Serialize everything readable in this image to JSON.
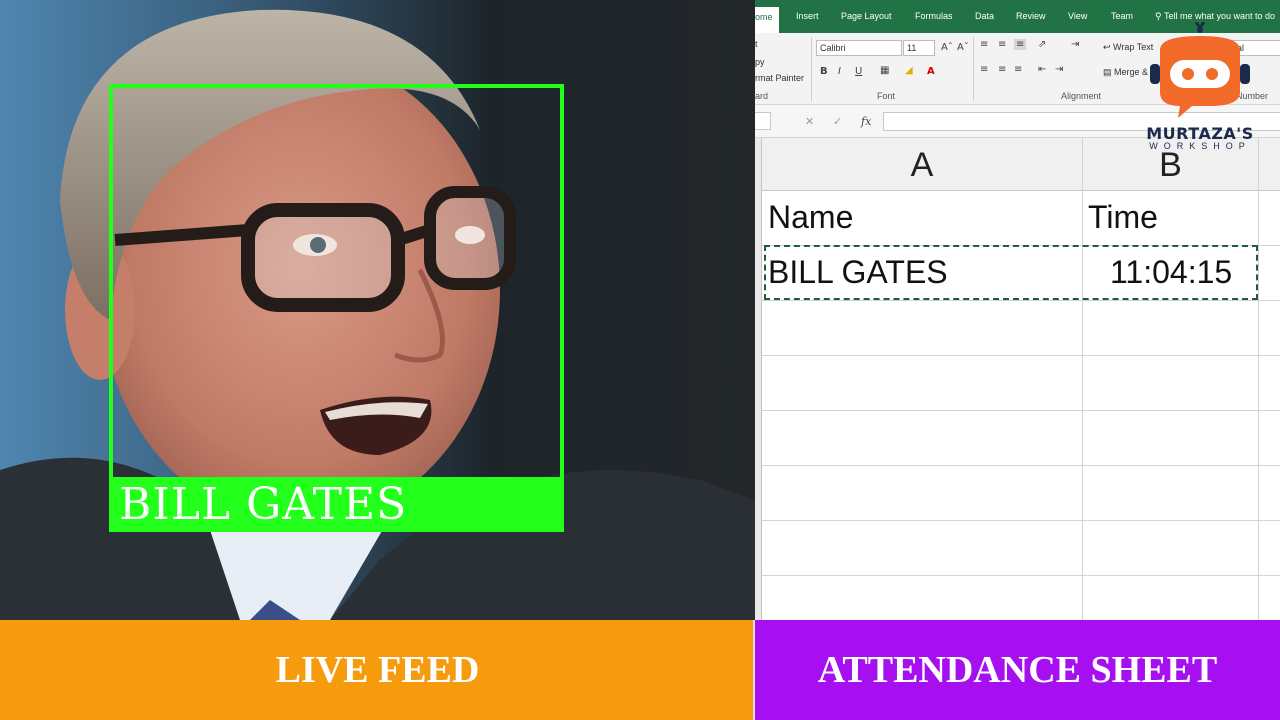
{
  "live_feed": {
    "detected_name": "BILL GATES",
    "box_color": "#22ff1a"
  },
  "excel": {
    "ribbon_tabs": [
      "ome",
      "Insert",
      "Page Layout",
      "Formulas",
      "Data",
      "Review",
      "View",
      "Team"
    ],
    "tell_me": "Tell me what you want to do",
    "clipboard": {
      "items": [
        "t",
        "py",
        "rmat Painter"
      ],
      "label": "ard"
    },
    "font": {
      "name": "Calibri",
      "size": "11",
      "label": "Font",
      "bold": "B",
      "italic": "I",
      "underline": "U"
    },
    "alignment": {
      "wrap_text": "Wrap Text",
      "merge_center": "Merge & Center",
      "label": "Alignment"
    },
    "number": {
      "format": "eral",
      "label": "Number"
    },
    "formula_bar": {
      "fx": "fx",
      "value": ""
    },
    "columns": [
      "A",
      "B"
    ],
    "rows": [
      [
        "Name",
        "Time"
      ],
      [
        "BILL GATES",
        "11:04:15"
      ]
    ]
  },
  "logo": {
    "title": "MURTAZA'S",
    "subtitle": "WORKSHOP",
    "brand_color": "#f26a2a"
  },
  "banners": {
    "left": "LIVE FEED",
    "right": "ATTENDANCE SHEET",
    "left_color": "#f59b0d",
    "right_color": "#a60ff0"
  }
}
